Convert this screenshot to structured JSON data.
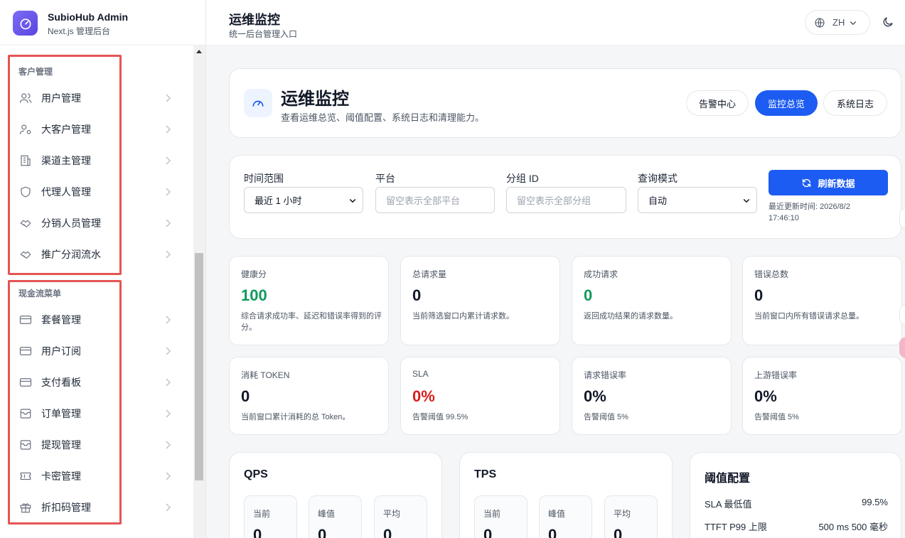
{
  "brand": {
    "title": "SubioHub Admin",
    "subtitle": "Next.js 管理后台"
  },
  "sidebar": {
    "groups": [
      {
        "title": "客户管理",
        "items": [
          {
            "label": "用户管理",
            "icon": "users-icon"
          },
          {
            "label": "大客户管理",
            "icon": "user-gear-icon"
          },
          {
            "label": "渠道主管理",
            "icon": "building-icon"
          },
          {
            "label": "代理人管理",
            "icon": "shield-icon"
          },
          {
            "label": "分销人员管理",
            "icon": "handshake-icon"
          },
          {
            "label": "推广分润流水",
            "icon": "handshake-icon"
          }
        ]
      },
      {
        "title": "现金流菜单",
        "items": [
          {
            "label": "套餐管理",
            "icon": "card-icon"
          },
          {
            "label": "用户订阅",
            "icon": "card-icon"
          },
          {
            "label": "支付看板",
            "icon": "card-icon"
          },
          {
            "label": "订单管理",
            "icon": "inbox-icon"
          },
          {
            "label": "提现管理",
            "icon": "inbox-icon"
          },
          {
            "label": "卡密管理",
            "icon": "ticket-icon"
          },
          {
            "label": "折扣码管理",
            "icon": "gift-icon"
          }
        ]
      }
    ]
  },
  "header": {
    "title": "运维监控",
    "subtitle": "统一后台管理入口",
    "lang": "ZH"
  },
  "hero": {
    "title": "运维监控",
    "subtitle": "查看运维总览、阈值配置、系统日志和清理能力。",
    "tabs": [
      {
        "label": "告警中心",
        "active": false
      },
      {
        "label": "监控总览",
        "active": true
      },
      {
        "label": "系统日志",
        "active": false
      }
    ]
  },
  "filters": {
    "time_label": "时间范围",
    "time_value": "最近 1 小时",
    "platform_label": "平台",
    "platform_placeholder": "留空表示全部平台",
    "group_label": "分组 ID",
    "group_placeholder": "留空表示全部分组",
    "mode_label": "查询模式",
    "mode_value": "自动",
    "refresh_label": "刷新数据",
    "updated": "最近更新时间: 2026/8/2 17:46:10"
  },
  "stats": [
    {
      "key": "健康分",
      "value": "100",
      "desc": "综合请求成功率、延迟和错误率得到的评分。",
      "tone": "green"
    },
    {
      "key": "总请求量",
      "value": "0",
      "desc": "当前筛选窗口内累计请求数。",
      "tone": ""
    },
    {
      "key": "成功请求",
      "value": "0",
      "desc": "返回成功结果的请求数量。",
      "tone": "green"
    },
    {
      "key": "错误总数",
      "value": "0",
      "desc": "当前窗口内所有错误请求总量。",
      "tone": ""
    },
    {
      "key": "消耗 TOKEN",
      "value": "0",
      "desc": "当前窗口累计消耗的总 Token。",
      "tone": ""
    },
    {
      "key": "SLA",
      "value": "0%",
      "desc": "告警阈值 99.5%",
      "tone": "red"
    },
    {
      "key": "请求错误率",
      "value": "0%",
      "desc": "告警阈值 5%",
      "tone": ""
    },
    {
      "key": "上游错误率",
      "value": "0%",
      "desc": "告警阈值 5%",
      "tone": ""
    }
  ],
  "qps": {
    "title": "QPS",
    "current_label": "当前",
    "current": "0",
    "peak_label": "峰值",
    "peak": "0",
    "avg_label": "平均",
    "avg": "0"
  },
  "tps": {
    "title": "TPS",
    "current_label": "当前",
    "current": "0",
    "peak_label": "峰值",
    "peak": "0",
    "avg_label": "平均",
    "avg": "0"
  },
  "thresholds": {
    "title": "阈值配置",
    "rows": [
      {
        "label": "SLA 最低值",
        "value": "99.5%"
      },
      {
        "label": "TTFT P99 上限",
        "value": "500 ms  500 毫秒"
      }
    ]
  },
  "colors": {
    "accent": "#1d5cf2",
    "success": "#0e9a5c",
    "danger": "#d81e1e",
    "highlight": "#e55454"
  }
}
